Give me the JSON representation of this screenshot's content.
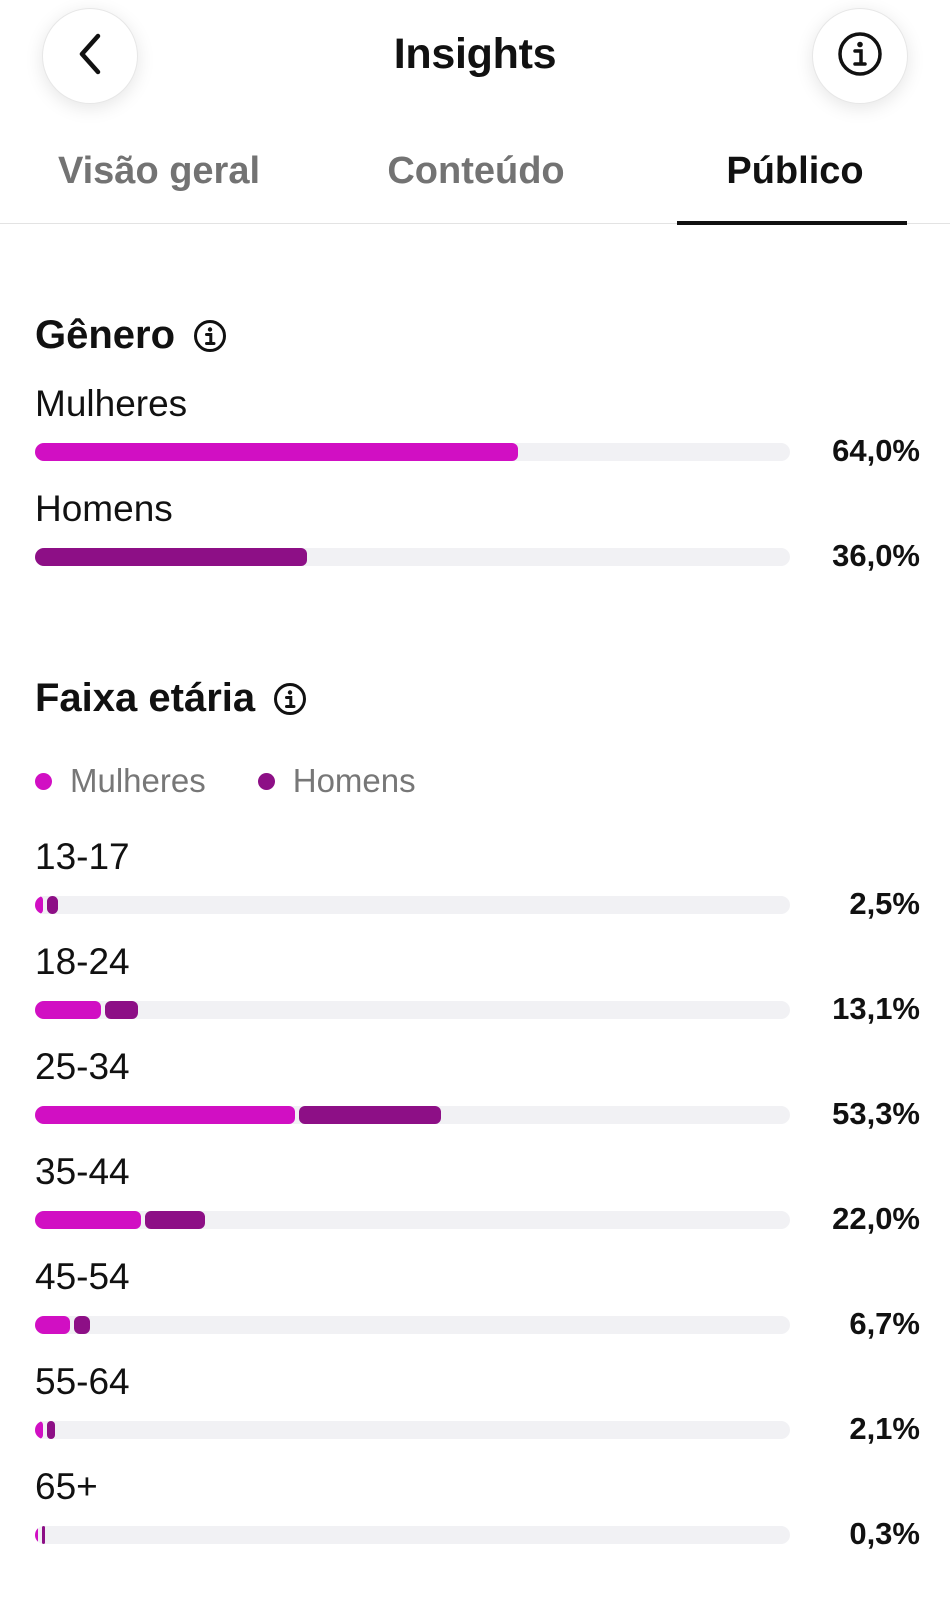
{
  "header": {
    "title": "Insights"
  },
  "tabs": [
    {
      "label": "Visão geral",
      "active": false
    },
    {
      "label": "Conteúdo",
      "active": false
    },
    {
      "label": "Público",
      "active": true
    }
  ],
  "colors": {
    "mulheres": "#d10fc3",
    "homens": "#8d0f86",
    "track": "#f1f1f4"
  },
  "icons": {
    "back": "chevron-left-icon",
    "info": "info-icon"
  },
  "genero": {
    "title": "Gênero",
    "rows": [
      {
        "label": "Mulheres",
        "value": 64.0,
        "value_text": "64,0%",
        "series": "mulheres"
      },
      {
        "label": "Homens",
        "value": 36.0,
        "value_text": "36,0%",
        "series": "homens"
      }
    ]
  },
  "faixa_etaria": {
    "title": "Faixa etária",
    "legend": [
      "Mulheres",
      "Homens"
    ],
    "rows": [
      {
        "label": "13-17",
        "total": 2.5,
        "total_text": "2,5%",
        "mulheres": 1.0,
        "homens": 1.5
      },
      {
        "label": "18-24",
        "total": 13.1,
        "total_text": "13,1%",
        "mulheres": 8.7,
        "homens": 4.4
      },
      {
        "label": "25-34",
        "total": 53.3,
        "total_text": "53,3%",
        "mulheres": 34.4,
        "homens": 18.9
      },
      {
        "label": "35-44",
        "total": 22.0,
        "total_text": "22,0%",
        "mulheres": 14.1,
        "homens": 7.9
      },
      {
        "label": "45-54",
        "total": 6.7,
        "total_text": "6,7%",
        "mulheres": 4.6,
        "homens": 2.1
      },
      {
        "label": "55-64",
        "total": 2.1,
        "total_text": "2,1%",
        "mulheres": 1.1,
        "homens": 1.0
      },
      {
        "label": "65+",
        "total": 0.3,
        "total_text": "0,3%",
        "mulheres": 0.2,
        "homens": 0.1
      }
    ]
  }
}
